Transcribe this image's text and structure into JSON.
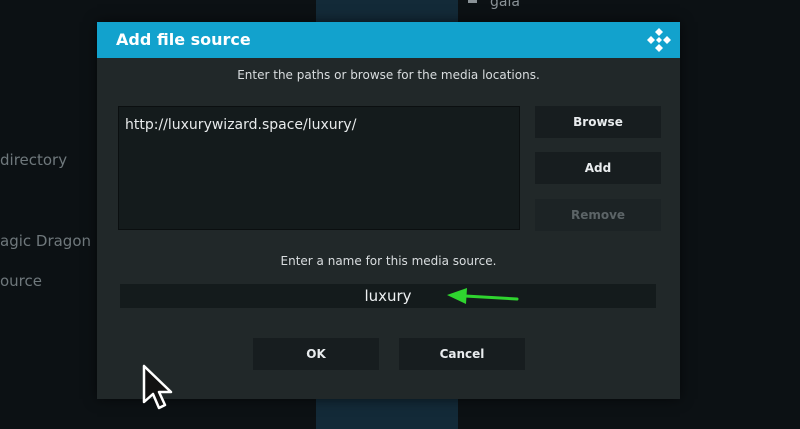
{
  "background": {
    "top_item": "gaia",
    "items": [
      "directory",
      "agic Dragon",
      "ource"
    ]
  },
  "dialog": {
    "title": "Add file source",
    "subtitle": "Enter the paths or browse for the media locations.",
    "paths": [
      "http://luxurywizard.space/luxury/"
    ],
    "buttons": {
      "browse": "Browse",
      "add": "Add",
      "remove": "Remove"
    },
    "name_label": "Enter a name for this media source.",
    "name_value": "luxury",
    "ok": "OK",
    "cancel": "Cancel"
  },
  "colors": {
    "title_bar": "#12a2cd",
    "dialog_bg": "#212829",
    "annotation_arrow": "#2fd42f"
  },
  "icons": {
    "title": "kodi-logo-icon",
    "annotation": "green-arrow-icon",
    "cursor": "mouse-pointer-icon"
  }
}
